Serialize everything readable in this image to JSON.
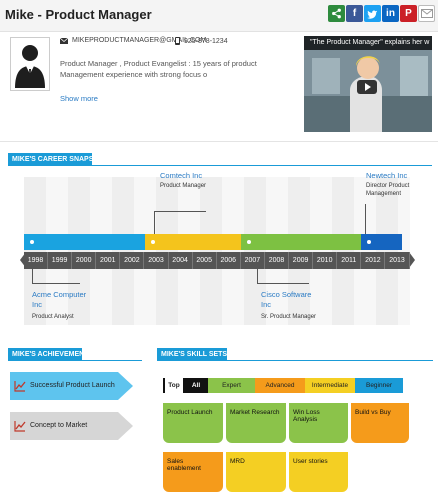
{
  "header": {
    "title": "Mike - Product Manager",
    "share_icons": [
      "share-icon",
      "facebook-icon",
      "twitter-icon",
      "linkedin-icon",
      "pinterest-icon",
      "mail-icon"
    ],
    "facebook_glyph": "f",
    "linkedin_glyph": "in",
    "pinterest_glyph": "P"
  },
  "profile": {
    "email": "MIKEPRODUCTMANAGER@GMAIL.COM",
    "phone": "925-878-1234",
    "bio": "Product Manager , Product Evangelist : 15 years of product Management experience with strong focus o",
    "show_more": "Show more",
    "video_title": "\"The Product Manager\" explains her w"
  },
  "career": {
    "section_title": "MIKE'S CAREER SNAPSHOT",
    "years": [
      "1998",
      "1999",
      "2000",
      "2001",
      "2002",
      "2003",
      "2004",
      "2005",
      "2006",
      "2007",
      "2008",
      "2009",
      "2010",
      "2011",
      "2012",
      "2013"
    ],
    "companies": [
      {
        "name_lines": [
          "Acme Computer",
          "Inc"
        ],
        "role": "Product Analyst",
        "start": "1998",
        "color": "#1aa3e0"
      },
      {
        "name_lines": [
          "Comtech Inc"
        ],
        "role": "Product Manager",
        "start": "2003",
        "color": "#f4c41c"
      },
      {
        "name_lines": [
          "Cisco Software",
          "Inc"
        ],
        "role": "Sr. Product Manager",
        "start": "2007",
        "color": "#7dc142"
      },
      {
        "name_lines": [
          "Newtech Inc"
        ],
        "role": "Director Product Management",
        "start": "2012",
        "color": "#1565c0"
      }
    ]
  },
  "achievements": {
    "section_title": "MIKE'S ACHIEVEMENTS",
    "items": [
      {
        "label": "Successful Product Launch",
        "color": "#5ec4ee"
      },
      {
        "label": "Concept to Market",
        "color": "#d6d6d6"
      }
    ]
  },
  "skills": {
    "section_title": "MIKE'S SKILL SETS",
    "filters": [
      {
        "label": "Top",
        "color": "#ffffff"
      },
      {
        "label": "All",
        "color": "#111111"
      },
      {
        "label": "Expert",
        "color": "#8bc34a"
      },
      {
        "label": "Advanced",
        "color": "#f59b1b"
      },
      {
        "label": "Intermediate",
        "color": "#f4cf23"
      },
      {
        "label": "Beginner",
        "color": "#1a9bd7"
      }
    ],
    "items": [
      {
        "label": "Product Launch",
        "level": "Expert"
      },
      {
        "label": "Market Research",
        "level": "Expert"
      },
      {
        "label": "Win Loss Analysis",
        "level": "Expert"
      },
      {
        "label": "Build vs Buy",
        "level": "Advanced"
      },
      {
        "label": "Sales enablement",
        "level": "Advanced"
      },
      {
        "label": "MRD",
        "level": "Intermediate"
      },
      {
        "label": "User stories",
        "level": "Intermediate"
      }
    ]
  },
  "colors": {
    "accent": "#1a9bd7",
    "link": "#2a7bc4",
    "timeline": "#555555"
  }
}
